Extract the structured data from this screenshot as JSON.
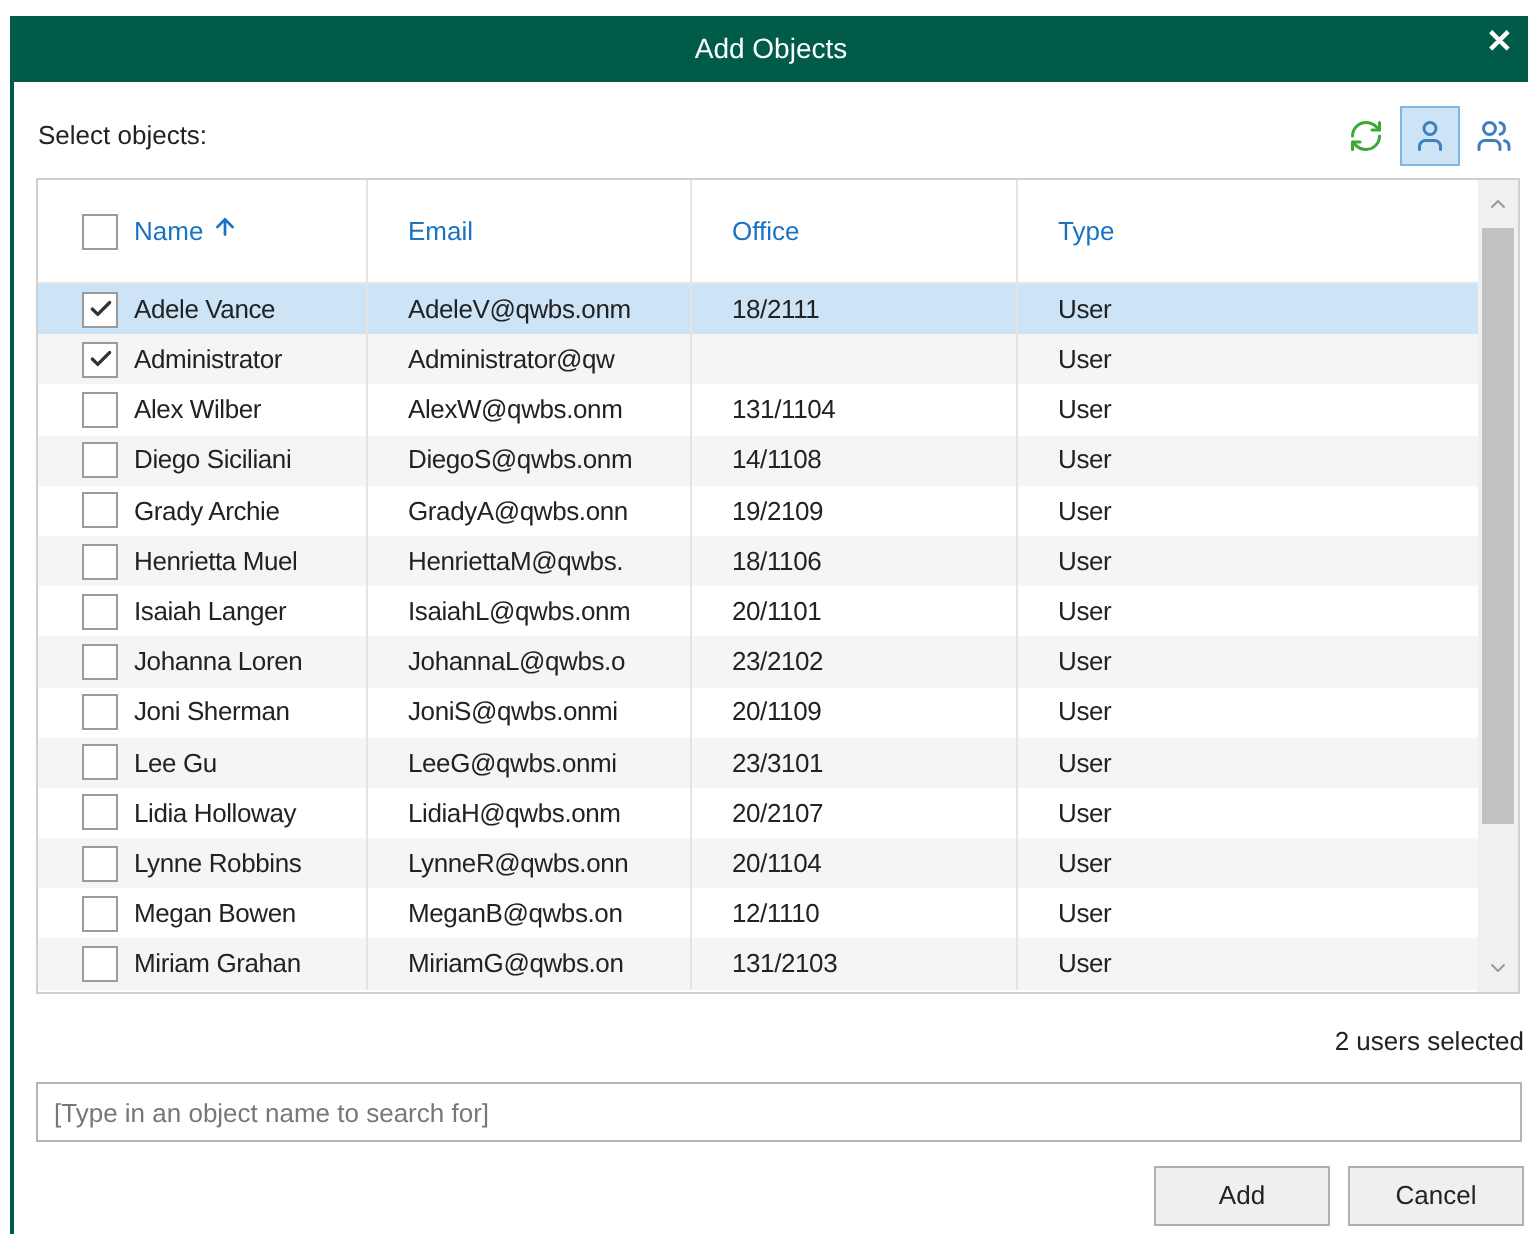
{
  "window": {
    "title": "Add Objects",
    "close": "✕"
  },
  "select_label": "Select objects:",
  "toolbar": [
    {
      "kind": "refresh",
      "selected": false
    },
    {
      "kind": "user",
      "selected": true
    },
    {
      "kind": "users",
      "selected": false
    }
  ],
  "table": {
    "columns": [
      "Name",
      "Email",
      "Office",
      "Type"
    ],
    "header_checked": false,
    "rows": [
      {
        "name": "Adele Vance",
        "email": "AdeleV@qwbs.onm",
        "office": "18/2111",
        "type": "User",
        "checked": true,
        "selected": true
      },
      {
        "name": "Administrator",
        "email": "Administrator@qw",
        "office": "",
        "type": "User",
        "checked": true,
        "selected": false
      },
      {
        "name": "Alex Wilber",
        "email": "AlexW@qwbs.onm",
        "office": "131/1104",
        "type": "User",
        "checked": false,
        "selected": false
      },
      {
        "name": "Diego Siciliani",
        "email": "DiegoS@qwbs.onm",
        "office": "14/1108",
        "type": "User",
        "checked": false,
        "selected": false
      },
      {
        "name": "Grady Archie",
        "email": "GradyA@qwbs.onn",
        "office": "19/2109",
        "type": "User",
        "checked": false,
        "selected": false
      },
      {
        "name": "Henrietta Muel",
        "email": "HenriettaM@qwbs.",
        "office": "18/1106",
        "type": "User",
        "checked": false,
        "selected": false
      },
      {
        "name": "Isaiah Langer",
        "email": "IsaiahL@qwbs.onm",
        "office": "20/1101",
        "type": "User",
        "checked": false,
        "selected": false
      },
      {
        "name": "Johanna Loren",
        "email": "JohannaL@qwbs.o",
        "office": "23/2102",
        "type": "User",
        "checked": false,
        "selected": false
      },
      {
        "name": "Joni Sherman",
        "email": "JoniS@qwbs.onmi",
        "office": "20/1109",
        "type": "User",
        "checked": false,
        "selected": false
      },
      {
        "name": "Lee Gu",
        "email": "LeeG@qwbs.onmi",
        "office": "23/3101",
        "type": "User",
        "checked": false,
        "selected": false
      },
      {
        "name": "Lidia Holloway",
        "email": "LidiaH@qwbs.onm",
        "office": "20/2107",
        "type": "User",
        "checked": false,
        "selected": false
      },
      {
        "name": "Lynne Robbins",
        "email": "LynneR@qwbs.onn",
        "office": "20/1104",
        "type": "User",
        "checked": false,
        "selected": false
      },
      {
        "name": "Megan Bowen",
        "email": "MeganB@qwbs.on",
        "office": "12/1110",
        "type": "User",
        "checked": false,
        "selected": false
      },
      {
        "name": "Miriam Grahan",
        "email": "MiriamG@qwbs.on",
        "office": "131/2103",
        "type": "User",
        "checked": false,
        "selected": false
      }
    ]
  },
  "status": "2 users selected",
  "search": {
    "placeholder": "[Type in an object name to search for]"
  },
  "buttons": [
    "Add",
    "Cancel"
  ]
}
